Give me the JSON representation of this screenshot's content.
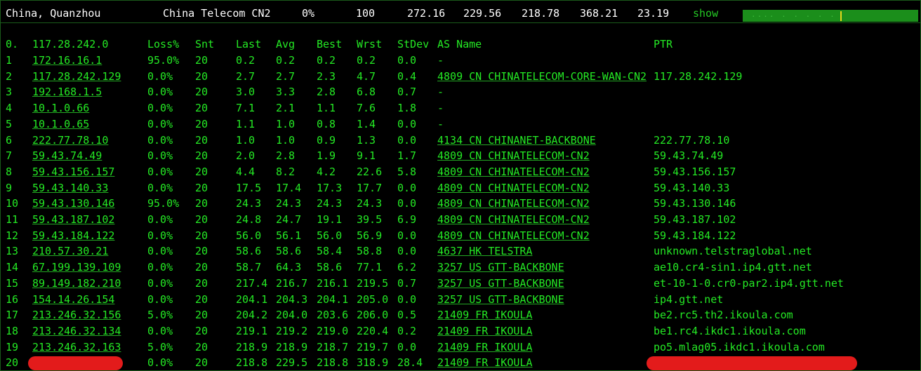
{
  "header": {
    "location": "China, Quanzhou",
    "isp": "China Telecom CN2",
    "loss": "0%",
    "sent": "100",
    "last": "272.16",
    "avg": "229.56",
    "best": "218.78",
    "worst": "368.21",
    "stdev": "23.19",
    "show_label": "show",
    "bar_text": "....  . .    .  .  ."
  },
  "columns": {
    "hop": "0.",
    "host": "117.28.242.0",
    "loss": "Loss%",
    "snt": "Snt",
    "last": "Last",
    "avg": "Avg",
    "best": "Best",
    "wrst": "Wrst",
    "stdev": "StDev",
    "asname": "AS Name",
    "ptr": "PTR"
  },
  "rows": [
    {
      "hop": "1",
      "host": "172.16.16.1",
      "loss": "95.0%",
      "snt": "20",
      "last": "0.2",
      "avg": "0.2",
      "best": "0.2",
      "wrst": "0.2",
      "stdev": "0.0",
      "asname": "-",
      "ptr": ""
    },
    {
      "hop": "2",
      "host": "117.28.242.129",
      "loss": "0.0%",
      "snt": "20",
      "last": "2.7",
      "avg": "2.7",
      "best": "2.3",
      "wrst": "4.7",
      "stdev": "0.4",
      "asname": "4809  CN CHINATELECOM-CORE-WAN-CN2",
      "ptr": "117.28.242.129"
    },
    {
      "hop": "3",
      "host": "192.168.1.5",
      "loss": "0.0%",
      "snt": "20",
      "last": "3.0",
      "avg": "3.3",
      "best": "2.8",
      "wrst": "6.8",
      "stdev": "0.7",
      "asname": "-",
      "ptr": ""
    },
    {
      "hop": "4",
      "host": "10.1.0.66",
      "loss": "0.0%",
      "snt": "20",
      "last": "7.1",
      "avg": "2.1",
      "best": "1.1",
      "wrst": "7.6",
      "stdev": "1.8",
      "asname": "-",
      "ptr": ""
    },
    {
      "hop": "5",
      "host": "10.1.0.65",
      "loss": "0.0%",
      "snt": "20",
      "last": "1.1",
      "avg": "1.0",
      "best": "0.8",
      "wrst": "1.4",
      "stdev": "0.0",
      "asname": "-",
      "ptr": ""
    },
    {
      "hop": "6",
      "host": "222.77.78.10",
      "loss": "0.0%",
      "snt": "20",
      "last": "1.0",
      "avg": "1.0",
      "best": "0.9",
      "wrst": "1.3",
      "stdev": "0.0",
      "asname": "4134  CN CHINANET-BACKBONE",
      "ptr": "222.77.78.10"
    },
    {
      "hop": "7",
      "host": "59.43.74.49",
      "loss": "0.0%",
      "snt": "20",
      "last": "2.0",
      "avg": "2.8",
      "best": "1.9",
      "wrst": "9.1",
      "stdev": "1.7",
      "asname": "4809  CN CHINATELECOM-CN2",
      "ptr": "59.43.74.49"
    },
    {
      "hop": "8",
      "host": "59.43.156.157",
      "loss": "0.0%",
      "snt": "20",
      "last": "4.4",
      "avg": "8.2",
      "best": "4.2",
      "wrst": "22.6",
      "stdev": "5.8",
      "asname": "4809  CN CHINATELECOM-CN2",
      "ptr": "59.43.156.157"
    },
    {
      "hop": "9",
      "host": "59.43.140.33",
      "loss": "0.0%",
      "snt": "20",
      "last": "17.5",
      "avg": "17.4",
      "best": "17.3",
      "wrst": "17.7",
      "stdev": "0.0",
      "asname": "4809  CN CHINATELECOM-CN2",
      "ptr": "59.43.140.33"
    },
    {
      "hop": "10",
      "host": "59.43.130.146",
      "loss": "95.0%",
      "snt": "20",
      "last": "24.3",
      "avg": "24.3",
      "best": "24.3",
      "wrst": "24.3",
      "stdev": "0.0",
      "asname": "4809  CN CHINATELECOM-CN2",
      "ptr": "59.43.130.146"
    },
    {
      "hop": "11",
      "host": "59.43.187.102",
      "loss": "0.0%",
      "snt": "20",
      "last": "24.8",
      "avg": "24.7",
      "best": "19.1",
      "wrst": "39.5",
      "stdev": "6.9",
      "asname": "4809  CN CHINATELECOM-CN2",
      "ptr": "59.43.187.102"
    },
    {
      "hop": "12",
      "host": "59.43.184.122",
      "loss": "0.0%",
      "snt": "20",
      "last": "56.0",
      "avg": "56.1",
      "best": "56.0",
      "wrst": "56.9",
      "stdev": "0.0",
      "asname": "4809  CN CHINATELECOM-CN2",
      "ptr": "59.43.184.122"
    },
    {
      "hop": "13",
      "host": "210.57.30.21",
      "loss": "0.0%",
      "snt": "20",
      "last": "58.6",
      "avg": "58.6",
      "best": "58.4",
      "wrst": "58.8",
      "stdev": "0.0",
      "asname": "4637  HK TELSTRA",
      "ptr": "unknown.telstraglobal.net"
    },
    {
      "hop": "14",
      "host": "67.199.139.109",
      "loss": "0.0%",
      "snt": "20",
      "last": "58.7",
      "avg": "64.3",
      "best": "58.6",
      "wrst": "77.1",
      "stdev": "6.2",
      "asname": "3257  US GTT-BACKBONE",
      "ptr": "ae10.cr4-sin1.ip4.gtt.net"
    },
    {
      "hop": "15",
      "host": "89.149.182.210",
      "loss": "0.0%",
      "snt": "20",
      "last": "217.4",
      "avg": "216.7",
      "best": "216.1",
      "wrst": "219.5",
      "stdev": "0.7",
      "asname": "3257  US GTT-BACKBONE",
      "ptr": "et-10-1-0.cr0-par2.ip4.gtt.net"
    },
    {
      "hop": "16",
      "host": "154.14.26.154",
      "loss": "0.0%",
      "snt": "20",
      "last": "204.1",
      "avg": "204.3",
      "best": "204.1",
      "wrst": "205.0",
      "stdev": "0.0",
      "asname": "3257  US GTT-BACKBONE",
      "ptr": "ip4.gtt.net"
    },
    {
      "hop": "17",
      "host": "213.246.32.156",
      "loss": "5.0%",
      "snt": "20",
      "last": "204.2",
      "avg": "204.0",
      "best": "203.6",
      "wrst": "206.0",
      "stdev": "0.5",
      "asname": "21409 FR IKOULA",
      "ptr": "be2.rc5.th2.ikoula.com"
    },
    {
      "hop": "18",
      "host": "213.246.32.134",
      "loss": "0.0%",
      "snt": "20",
      "last": "219.1",
      "avg": "219.2",
      "best": "219.0",
      "wrst": "220.4",
      "stdev": "0.2",
      "asname": "21409 FR IKOULA",
      "ptr": "be1.rc4.ikdc1.ikoula.com"
    },
    {
      "hop": "19",
      "host": "213.246.32.163",
      "loss": "5.0%",
      "snt": "20",
      "last": "218.9",
      "avg": "218.9",
      "best": "218.7",
      "wrst": "219.7",
      "stdev": "0.0",
      "asname": "21409 FR IKOULA",
      "ptr": "po5.mlag05.ikdc1.ikoula.com"
    },
    {
      "hop": "20",
      "host": "",
      "loss": "0.0%",
      "snt": "20",
      "last": "218.8",
      "avg": "229.5",
      "best": "218.8",
      "wrst": "318.9",
      "stdev": "28.4",
      "asname": "21409 FR IKOULA",
      "ptr": "",
      "redacted": true
    }
  ],
  "colors": {
    "text": "#24e924",
    "header_text": "#ffffff",
    "bar": "#1b8e1b",
    "marker": "#e8d81c",
    "redaction": "#e31b1b"
  }
}
